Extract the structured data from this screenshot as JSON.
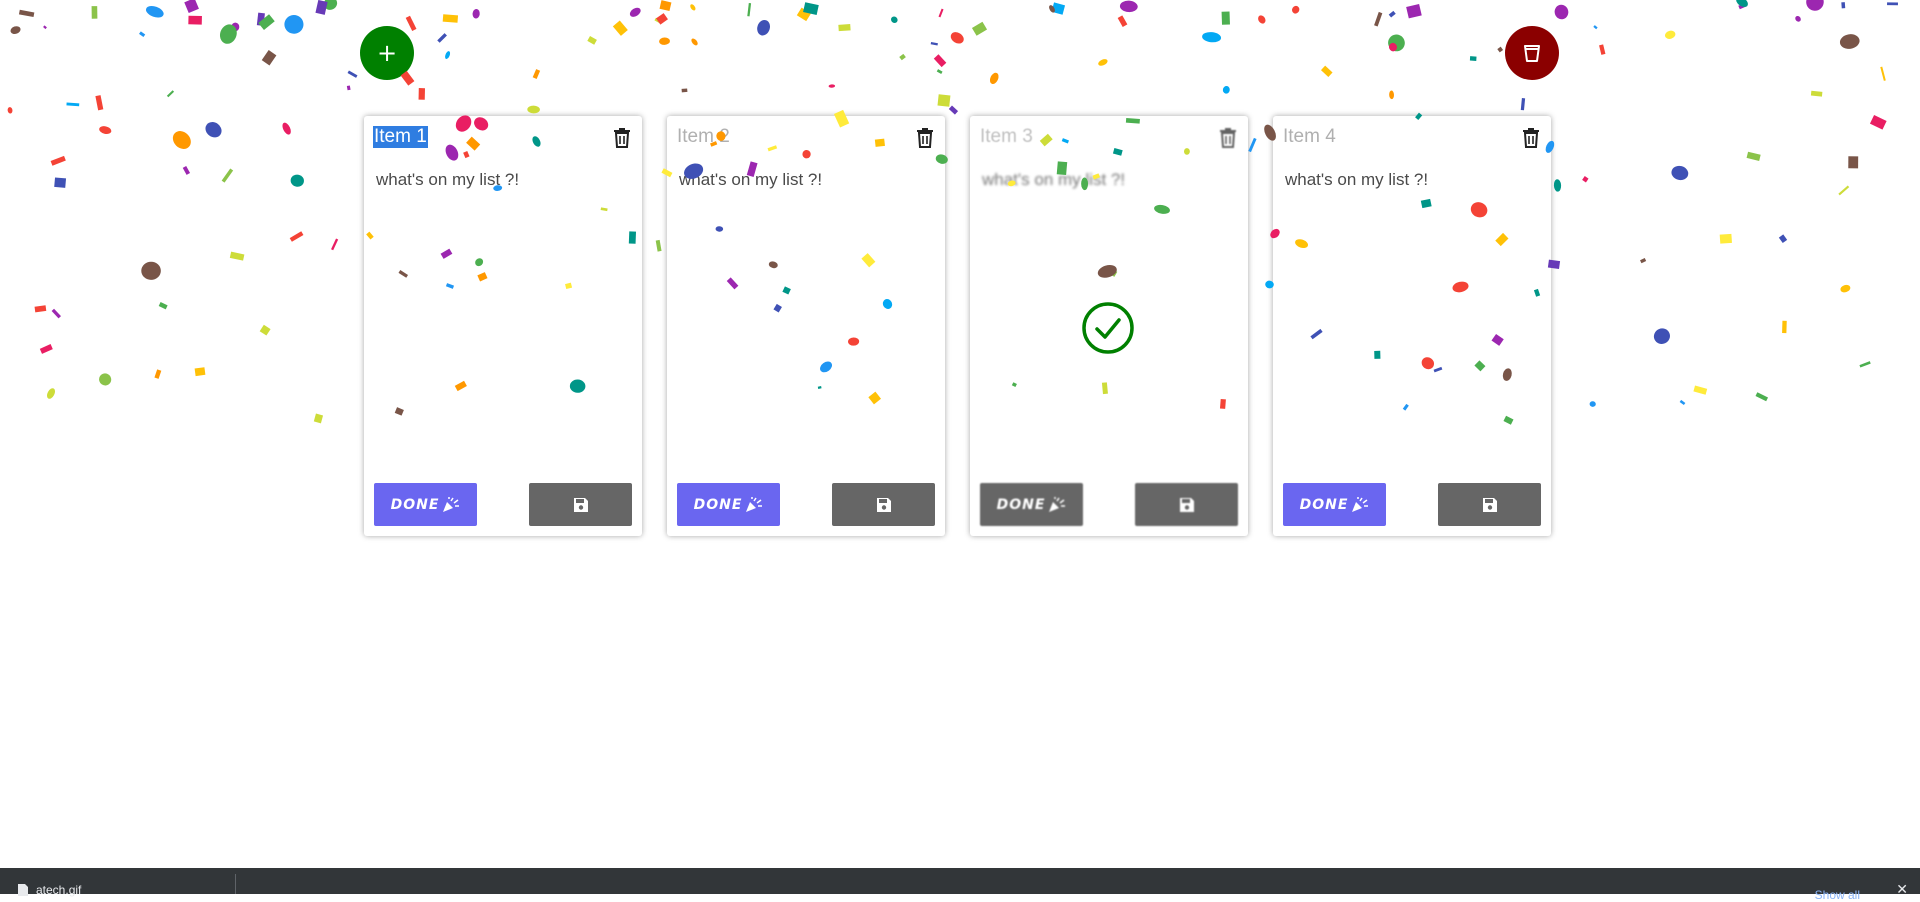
{
  "toolbar": {
    "add_label": "+",
    "add_color": "#008000",
    "delete_all_icon": "bucket-icon",
    "delete_all_color": "#8b0000"
  },
  "cards": [
    {
      "title": "Item 1",
      "text": "what's on my list ?!",
      "done_label": "DONE",
      "title_selected": true,
      "done": false
    },
    {
      "title": "Item 2",
      "text": "what's on my list ?!",
      "done_label": "DONE",
      "title_selected": false,
      "done": false
    },
    {
      "title": "Item 3",
      "text": "what's on my list ?!",
      "done_label": "DONE",
      "title_selected": false,
      "done": true
    },
    {
      "title": "Item 4",
      "text": "what's on my list ?!",
      "done_label": "DONE",
      "title_selected": false,
      "done": false
    }
  ],
  "colors": {
    "done_button": "#6a66f0",
    "save_button": "#666666",
    "check": "#008000",
    "confetti": [
      "#e91e63",
      "#4caf50",
      "#2196f3",
      "#ff9800",
      "#9c27b0",
      "#ffeb3b",
      "#3f51b5",
      "#cddc39",
      "#009688",
      "#795548",
      "#f44336",
      "#03a9f4",
      "#673ab7",
      "#ffc107",
      "#8bc34a"
    ]
  },
  "download_bar": {
    "file_label": "atech.gif",
    "show_all_label": "Show all",
    "close_label": "✕"
  }
}
